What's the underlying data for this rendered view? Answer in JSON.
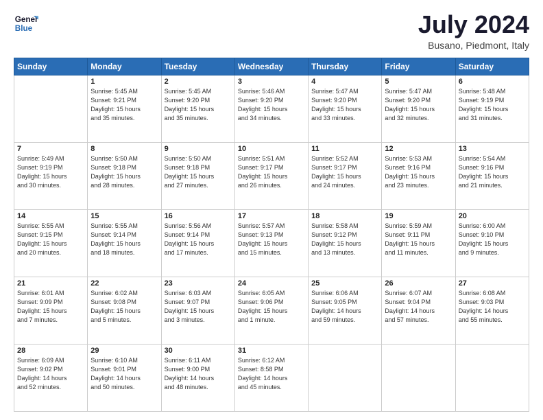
{
  "header": {
    "logo_line1": "General",
    "logo_line2": "Blue",
    "month": "July 2024",
    "location": "Busano, Piedmont, Italy"
  },
  "weekdays": [
    "Sunday",
    "Monday",
    "Tuesday",
    "Wednesday",
    "Thursday",
    "Friday",
    "Saturday"
  ],
  "weeks": [
    [
      {
        "day": "",
        "info": ""
      },
      {
        "day": "1",
        "info": "Sunrise: 5:45 AM\nSunset: 9:21 PM\nDaylight: 15 hours\nand 35 minutes."
      },
      {
        "day": "2",
        "info": "Sunrise: 5:45 AM\nSunset: 9:20 PM\nDaylight: 15 hours\nand 35 minutes."
      },
      {
        "day": "3",
        "info": "Sunrise: 5:46 AM\nSunset: 9:20 PM\nDaylight: 15 hours\nand 34 minutes."
      },
      {
        "day": "4",
        "info": "Sunrise: 5:47 AM\nSunset: 9:20 PM\nDaylight: 15 hours\nand 33 minutes."
      },
      {
        "day": "5",
        "info": "Sunrise: 5:47 AM\nSunset: 9:20 PM\nDaylight: 15 hours\nand 32 minutes."
      },
      {
        "day": "6",
        "info": "Sunrise: 5:48 AM\nSunset: 9:19 PM\nDaylight: 15 hours\nand 31 minutes."
      }
    ],
    [
      {
        "day": "7",
        "info": "Sunrise: 5:49 AM\nSunset: 9:19 PM\nDaylight: 15 hours\nand 30 minutes."
      },
      {
        "day": "8",
        "info": "Sunrise: 5:50 AM\nSunset: 9:18 PM\nDaylight: 15 hours\nand 28 minutes."
      },
      {
        "day": "9",
        "info": "Sunrise: 5:50 AM\nSunset: 9:18 PM\nDaylight: 15 hours\nand 27 minutes."
      },
      {
        "day": "10",
        "info": "Sunrise: 5:51 AM\nSunset: 9:17 PM\nDaylight: 15 hours\nand 26 minutes."
      },
      {
        "day": "11",
        "info": "Sunrise: 5:52 AM\nSunset: 9:17 PM\nDaylight: 15 hours\nand 24 minutes."
      },
      {
        "day": "12",
        "info": "Sunrise: 5:53 AM\nSunset: 9:16 PM\nDaylight: 15 hours\nand 23 minutes."
      },
      {
        "day": "13",
        "info": "Sunrise: 5:54 AM\nSunset: 9:16 PM\nDaylight: 15 hours\nand 21 minutes."
      }
    ],
    [
      {
        "day": "14",
        "info": "Sunrise: 5:55 AM\nSunset: 9:15 PM\nDaylight: 15 hours\nand 20 minutes."
      },
      {
        "day": "15",
        "info": "Sunrise: 5:55 AM\nSunset: 9:14 PM\nDaylight: 15 hours\nand 18 minutes."
      },
      {
        "day": "16",
        "info": "Sunrise: 5:56 AM\nSunset: 9:14 PM\nDaylight: 15 hours\nand 17 minutes."
      },
      {
        "day": "17",
        "info": "Sunrise: 5:57 AM\nSunset: 9:13 PM\nDaylight: 15 hours\nand 15 minutes."
      },
      {
        "day": "18",
        "info": "Sunrise: 5:58 AM\nSunset: 9:12 PM\nDaylight: 15 hours\nand 13 minutes."
      },
      {
        "day": "19",
        "info": "Sunrise: 5:59 AM\nSunset: 9:11 PM\nDaylight: 15 hours\nand 11 minutes."
      },
      {
        "day": "20",
        "info": "Sunrise: 6:00 AM\nSunset: 9:10 PM\nDaylight: 15 hours\nand 9 minutes."
      }
    ],
    [
      {
        "day": "21",
        "info": "Sunrise: 6:01 AM\nSunset: 9:09 PM\nDaylight: 15 hours\nand 7 minutes."
      },
      {
        "day": "22",
        "info": "Sunrise: 6:02 AM\nSunset: 9:08 PM\nDaylight: 15 hours\nand 5 minutes."
      },
      {
        "day": "23",
        "info": "Sunrise: 6:03 AM\nSunset: 9:07 PM\nDaylight: 15 hours\nand 3 minutes."
      },
      {
        "day": "24",
        "info": "Sunrise: 6:05 AM\nSunset: 9:06 PM\nDaylight: 15 hours\nand 1 minute."
      },
      {
        "day": "25",
        "info": "Sunrise: 6:06 AM\nSunset: 9:05 PM\nDaylight: 14 hours\nand 59 minutes."
      },
      {
        "day": "26",
        "info": "Sunrise: 6:07 AM\nSunset: 9:04 PM\nDaylight: 14 hours\nand 57 minutes."
      },
      {
        "day": "27",
        "info": "Sunrise: 6:08 AM\nSunset: 9:03 PM\nDaylight: 14 hours\nand 55 minutes."
      }
    ],
    [
      {
        "day": "28",
        "info": "Sunrise: 6:09 AM\nSunset: 9:02 PM\nDaylight: 14 hours\nand 52 minutes."
      },
      {
        "day": "29",
        "info": "Sunrise: 6:10 AM\nSunset: 9:01 PM\nDaylight: 14 hours\nand 50 minutes."
      },
      {
        "day": "30",
        "info": "Sunrise: 6:11 AM\nSunset: 9:00 PM\nDaylight: 14 hours\nand 48 minutes."
      },
      {
        "day": "31",
        "info": "Sunrise: 6:12 AM\nSunset: 8:58 PM\nDaylight: 14 hours\nand 45 minutes."
      },
      {
        "day": "",
        "info": ""
      },
      {
        "day": "",
        "info": ""
      },
      {
        "day": "",
        "info": ""
      }
    ]
  ]
}
